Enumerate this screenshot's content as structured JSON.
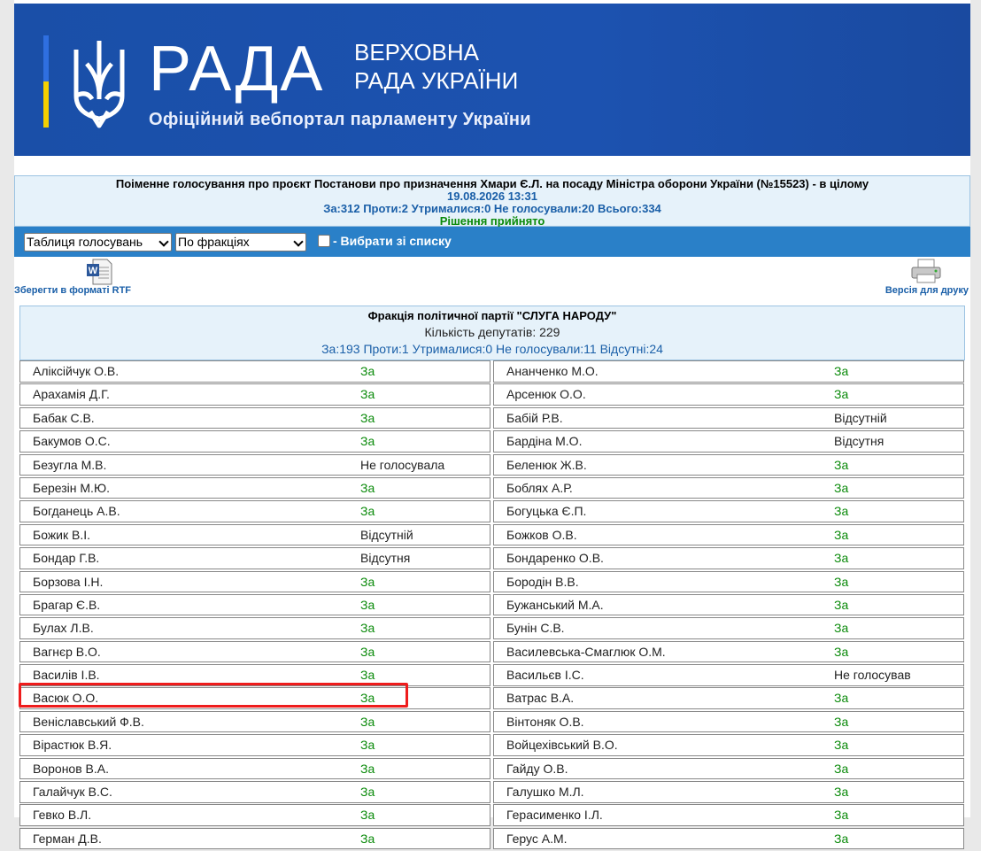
{
  "header": {
    "logo": "РАДА",
    "sub1": "ВЕРХОВНА",
    "sub2": "РАДА УКРАЇНИ",
    "portal": "Офіційний вебпортал парламенту України"
  },
  "vote": {
    "title": "Поіменне голосування про проєкт Постанови про призначення Хмари Є.Л. на посаду Міністра оборони України (№15523) - в цілому",
    "datetime": "19.08.2026 13:31",
    "stats": "За:312 Проти:2 Утрималися:0 Не голосували:20 Всього:334",
    "result": "Рішення прийнято"
  },
  "toolbar": {
    "view_select": "Таблиця голосувань",
    "group_select": "По фракціях",
    "choose_label": "- Вибрати зі списку"
  },
  "actions": {
    "rtf_label": "Зберегти в форматі RTF",
    "print_label": "Версія для друку"
  },
  "faction": {
    "name": "Фракція політичної партії \"СЛУГА НАРОДУ\"",
    "count": "Кількість депутатів: 229",
    "stats": "За:193 Проти:1 Утрималися:0 Не голосували:11 Відсутні:24"
  },
  "left": [
    {
      "name": "Аліксійчук О.В.",
      "vote": "За"
    },
    {
      "name": "Арахамія Д.Г.",
      "vote": "За"
    },
    {
      "name": "Бабак С.В.",
      "vote": "За"
    },
    {
      "name": "Бакумов О.С.",
      "vote": "За"
    },
    {
      "name": "Безугла М.В.",
      "vote": "Не голосувала"
    },
    {
      "name": "Березін М.Ю.",
      "vote": "За"
    },
    {
      "name": "Богданець А.В.",
      "vote": "За"
    },
    {
      "name": "Божик В.І.",
      "vote": "Відсутній"
    },
    {
      "name": "Бондар Г.В.",
      "vote": "Відсутня"
    },
    {
      "name": "Борзова І.Н.",
      "vote": "За"
    },
    {
      "name": "Брагар Є.В.",
      "vote": "За"
    },
    {
      "name": "Булах Л.В.",
      "vote": "За"
    },
    {
      "name": "Вагнєр В.О.",
      "vote": "За"
    },
    {
      "name": "Василів І.В.",
      "vote": "За"
    },
    {
      "name": "Васюк О.О.",
      "vote": "За"
    },
    {
      "name": "Веніславський Ф.В.",
      "vote": "За"
    },
    {
      "name": "Вірастюк В.Я.",
      "vote": "За"
    },
    {
      "name": "Воронов В.А.",
      "vote": "За"
    },
    {
      "name": "Галайчук В.С.",
      "vote": "За"
    },
    {
      "name": "Гевко В.Л.",
      "vote": "За"
    },
    {
      "name": "Герман Д.В.",
      "vote": "За"
    }
  ],
  "right": [
    {
      "name": "Ананченко М.О.",
      "vote": "За"
    },
    {
      "name": "Арсенюк О.О.",
      "vote": "За"
    },
    {
      "name": "Бабій Р.В.",
      "vote": "Відсутній"
    },
    {
      "name": "Бардіна М.О.",
      "vote": "Відсутня"
    },
    {
      "name": "Беленюк Ж.В.",
      "vote": "За"
    },
    {
      "name": "Боблях А.Р.",
      "vote": "За"
    },
    {
      "name": "Богуцька Є.П.",
      "vote": "За"
    },
    {
      "name": "Божков О.В.",
      "vote": "За"
    },
    {
      "name": "Бондаренко О.В.",
      "vote": "За"
    },
    {
      "name": "Бородін В.В.",
      "vote": "За"
    },
    {
      "name": "Бужанський М.А.",
      "vote": "За"
    },
    {
      "name": "Бунін С.В.",
      "vote": "За"
    },
    {
      "name": "Василевська-Смаглюк О.М.",
      "vote": "За"
    },
    {
      "name": "Васильєв І.С.",
      "vote": "Не голосував"
    },
    {
      "name": "Ватрас В.А.",
      "vote": "За"
    },
    {
      "name": "Вінтоняк О.В.",
      "vote": "За"
    },
    {
      "name": "Войцехівський В.О.",
      "vote": "За"
    },
    {
      "name": "Гайду О.В.",
      "vote": "За"
    },
    {
      "name": "Галушко М.Л.",
      "vote": "За"
    },
    {
      "name": "Герасименко І.Л.",
      "vote": "За"
    },
    {
      "name": "Герус А.М.",
      "vote": "За"
    }
  ]
}
